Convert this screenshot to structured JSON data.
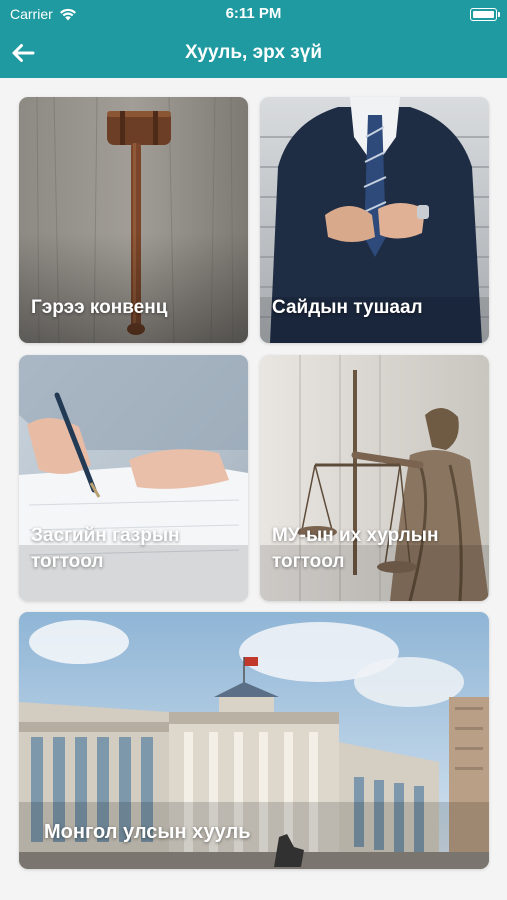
{
  "status_bar": {
    "carrier": "Carrier",
    "time": "6:11 PM"
  },
  "nav": {
    "title": "Хууль, эрх зүй",
    "back_icon": "arrow-left-icon"
  },
  "colors": {
    "brand": "#1f9aa0",
    "background": "#f4f4f4"
  },
  "cards": [
    {
      "label": "Гэрээ конвенц",
      "image": "gavel-photo"
    },
    {
      "label": "Сайдын тушаал",
      "image": "businessman-suit-photo"
    },
    {
      "label": "Засгийн газрын тогтоол",
      "image": "hand-writing-photo"
    },
    {
      "label": "МУ-ын их хурлын тогтоол",
      "image": "lady-justice-statue-photo"
    },
    {
      "label": "Монгол улсын хууль",
      "image": "government-palace-photo"
    }
  ]
}
